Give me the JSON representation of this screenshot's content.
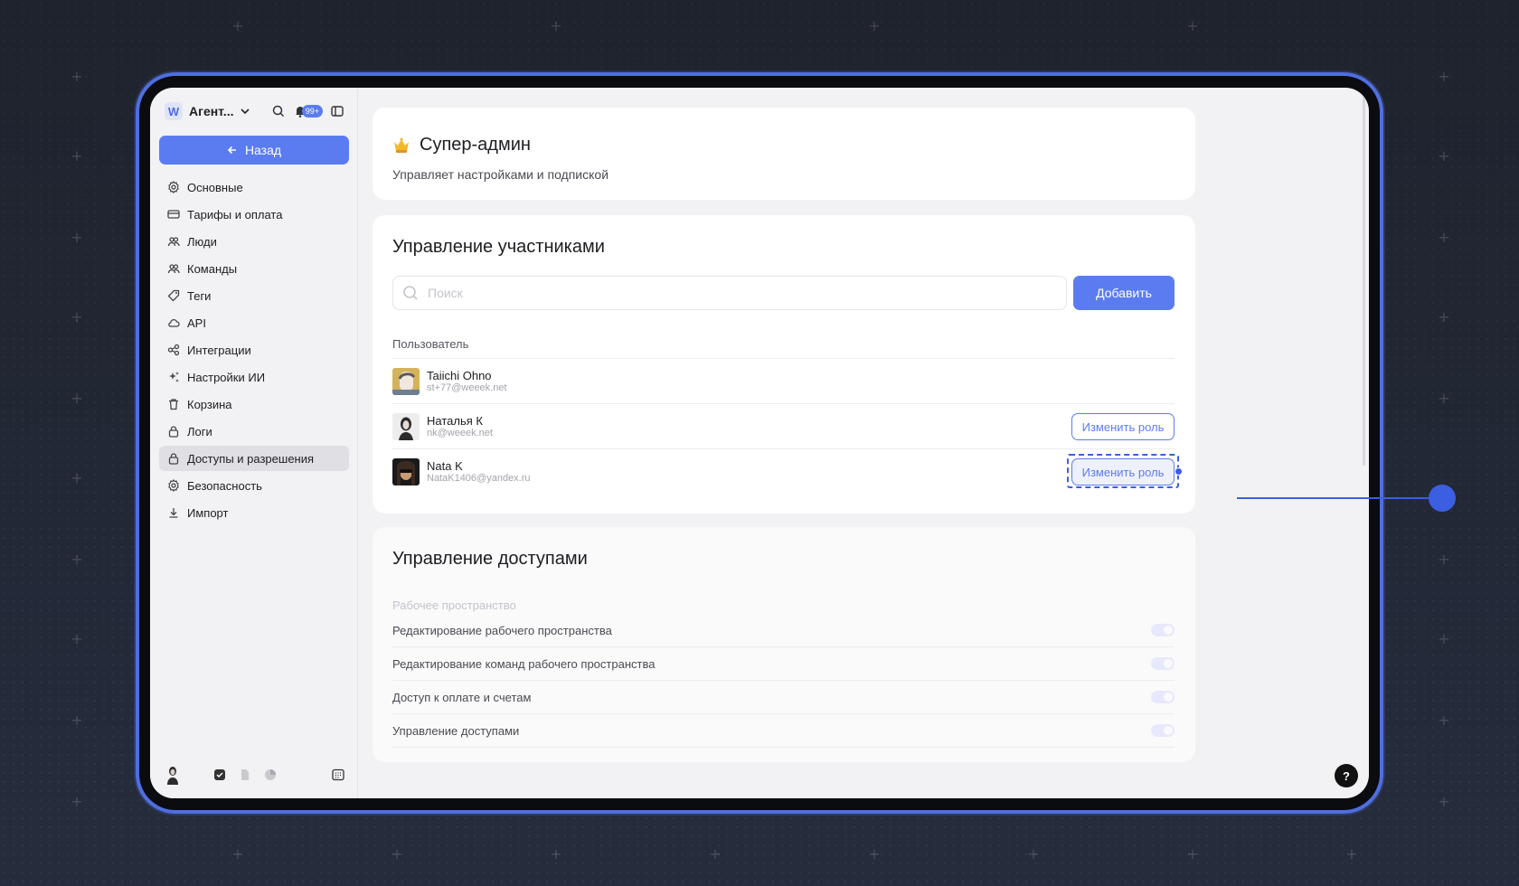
{
  "sidebar": {
    "workspace_logo": "W",
    "workspace_name": "Агент...",
    "notifications_badge": "99+",
    "back_label": "Назад",
    "items": [
      {
        "label": "Основные",
        "icon": "gear-icon"
      },
      {
        "label": "Тарифы и оплата",
        "icon": "card-icon"
      },
      {
        "label": "Люди",
        "icon": "people-icon"
      },
      {
        "label": "Команды",
        "icon": "team-icon"
      },
      {
        "label": "Теги",
        "icon": "tag-icon"
      },
      {
        "label": "API",
        "icon": "cloud-icon"
      },
      {
        "label": "Интеграции",
        "icon": "integrations-icon"
      },
      {
        "label": "Настройки ИИ",
        "icon": "sparkle-icon"
      },
      {
        "label": "Корзина",
        "icon": "trash-icon"
      },
      {
        "label": "Логи",
        "icon": "lock-icon"
      },
      {
        "label": "Доступы и разрешения",
        "icon": "lock-icon",
        "active": true
      },
      {
        "label": "Безопасность",
        "icon": "gear-icon"
      },
      {
        "label": "Импорт",
        "icon": "download-icon"
      }
    ]
  },
  "role": {
    "title": "Супер-админ",
    "description": "Управляет настройками и подпиской"
  },
  "members": {
    "title": "Управление участниками",
    "search_placeholder": "Поиск",
    "add_label": "Добавить",
    "column_user": "Пользователь",
    "change_role_label": "Изменить роль",
    "users": [
      {
        "name": "Taiichi Ohno",
        "email": "st+77@weeek.net"
      },
      {
        "name": "Наталья К",
        "email": "nk@weeek.net"
      },
      {
        "name": "Nata K",
        "email": "NataK1406@yandex.ru"
      }
    ]
  },
  "access": {
    "title": "Управление доступами",
    "group": "Рабочее пространство",
    "permissions": [
      "Редактирование рабочего пространства",
      "Редактирование команд рабочего пространства",
      "Доступ к оплате и счетам",
      "Управление доступами"
    ]
  },
  "help_label": "?",
  "colors": {
    "accent": "#5b7cf0",
    "highlight": "#3b5fe0",
    "frame": "#4f6ee0",
    "background": "#262b38"
  }
}
